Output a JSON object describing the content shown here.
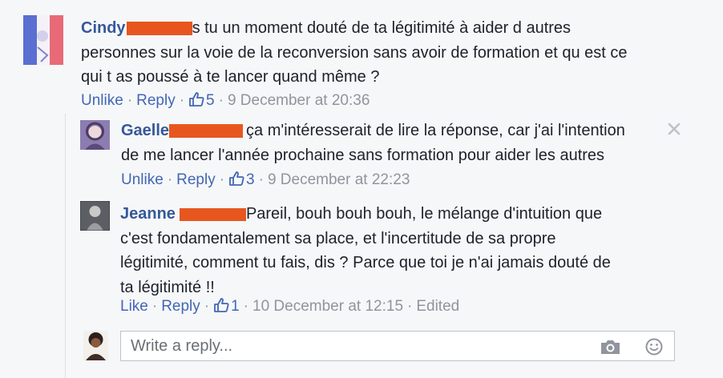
{
  "comments": [
    {
      "author": "Cindy",
      "line1": "s tu un moment douté de ta légitimité à aider d autres",
      "line2": "personnes sur la voie de la reconversion sans avoir de formation et qu est ce",
      "line3": "qui t as poussé à te lancer quand même ?",
      "action": "Unlike",
      "reply": "Reply",
      "likes": "5",
      "time": "9 December at 20:36"
    },
    {
      "author": "Gaelle",
      "line1": "ça m'intéresserait de lire la réponse, car j'ai l'intention",
      "line2": "de me lancer l'année prochaine sans formation pour aider les autres",
      "action": "Unlike",
      "reply": "Reply",
      "likes": "3",
      "time": "9 December at 22:23"
    },
    {
      "author": "Jeanne",
      "line1": "Pareil, bouh bouh bouh, le mélange d'intuition que",
      "line2": "c'est fondamentalement sa place, et l'incertitude de sa propre",
      "line3": "légitimité, comment tu fais, dis ? Parce que toi je n'ai jamais douté de",
      "line4": "ta légitimité !!",
      "action": "Like",
      "reply": "Reply",
      "likes": "1",
      "time": "10 December at 12:15",
      "edited": "Edited"
    }
  ],
  "separator": "·",
  "reply_box": {
    "placeholder": "Write a reply..."
  },
  "icons": [
    "thumbs-up-icon",
    "close-icon",
    "camera-icon",
    "emoji-icon"
  ],
  "colors": {
    "link": "#4267b2",
    "name": "#365899",
    "meta": "#90949c",
    "redaction": "#e8561f"
  }
}
